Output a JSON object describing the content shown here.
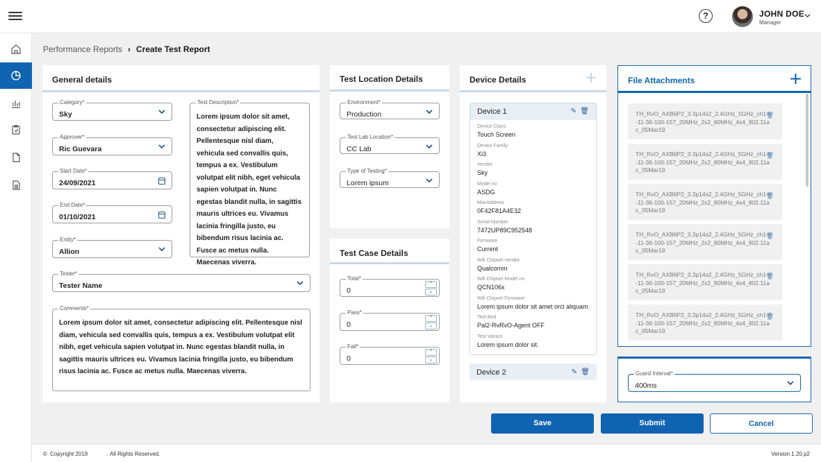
{
  "header": {
    "user_name": "JOHN DOE",
    "user_role": "Manager"
  },
  "breadcrumb": {
    "parent": "Performance Reports",
    "current": "Create Test Report"
  },
  "general": {
    "title": "General details",
    "category": {
      "label": "Category*",
      "value": "Sky"
    },
    "approver": {
      "label": "Approver*",
      "value": "Ric Guevara"
    },
    "start_date": {
      "label": "Start Date*",
      "value": "24/09/2021"
    },
    "end_date": {
      "label": "End Date*",
      "value": "01/10/2021"
    },
    "entity": {
      "label": "Entity*",
      "value": "Allion"
    },
    "description": {
      "label": "Test Description*",
      "value": "Lorem ipsum dolor sit amet, consectetur adipiscing elit. Pellentesque nisl diam, vehicula sed convallis quis, tempus a ex. Vestibulum volutpat elit nibh, eget vehicula sapien volutpat in. Nunc egestas blandit nulla, in sagittis mauris ultrices eu. Vivamus lacinia fringilla justo, eu bibendum risus lacinia ac. Fusce ac metus nulla. Maecenas viverra."
    },
    "tester": {
      "label": "Tester*",
      "value": "Tester Name"
    },
    "comments": {
      "label": "Comments*",
      "value": "Lorem ipsum dolor sit amet, consectetur adipiscing elit. Pellentesque nisl diam, vehicula sed convallis quis, tempus a ex. Vestibulum volutpat elit nibh, eget vehicula sapien volutpat in. Nunc egestas blandit nulla, in sagittis mauris ultrices eu. Vivamus lacinia fringilla justo, eu bibendum risus lacinia ac. Fusce ac metus nulla. Maecenas viverra."
    }
  },
  "location": {
    "title": "Test Location Details",
    "environment": {
      "label": "Environment*",
      "value": "Production"
    },
    "lab": {
      "label": "Test Lab Location*",
      "value": "CC Lab"
    },
    "testing_type": {
      "label": "Type of Testing*",
      "value": "Lorem ipsum"
    }
  },
  "testcase": {
    "title": "Test Case Details",
    "total": {
      "label": "Total*",
      "value": "0"
    },
    "pass": {
      "label": "Pass*",
      "value": "0"
    },
    "fail": {
      "label": "Fail*",
      "value": "0"
    }
  },
  "devices": {
    "title": "Device Details",
    "device1": {
      "name": "Device 1",
      "fields": [
        {
          "k": "Device Class",
          "v": "Touch Screen"
        },
        {
          "k": "Device Family",
          "v": "Xi3"
        },
        {
          "k": "Vendor",
          "v": "Sky"
        },
        {
          "k": "Model no",
          "v": "ASDG"
        },
        {
          "k": "MacAddress",
          "v": "0F42F81A4E32"
        },
        {
          "k": "Serial Number",
          "v": "7472UP89C952548"
        },
        {
          "k": "Firmware",
          "v": "Current"
        },
        {
          "k": "Wifi Chipset Vendor",
          "v": "Qualcomm"
        },
        {
          "k": "Wifi Chipset Model no",
          "v": "QCN106x"
        },
        {
          "k": "Wifi Chipset Firmware",
          "v": "Lorem ipsum dolor sit amet orci aliquam."
        },
        {
          "k": "Test Bed",
          "v": "Pal2-RvRvO-Agent OFF"
        },
        {
          "k": "Test Variant",
          "v": "Lorem ipsum dolor sit."
        }
      ]
    },
    "device2": {
      "name": "Device 2"
    }
  },
  "attachments": {
    "title": "File Attachments",
    "files": [
      "TH_RvO_AXB6P2_3.3p14s2_2.4GHz_5GHz_ch1-6-11-36-100-157_20MHz_2x2_80MHz_4x4_802.11ac_05Mar19",
      "TH_RvO_AXB6P2_3.3p14s2_2.4GHz_5GHz_ch1-6-11-36-100-157_20MHz_2x2_80MHz_4x4_802.11ac_05Mar19",
      "TH_RvO_AXB6P2_3.3p14s2_2.4GHz_5GHz_ch1-6-11-36-100-157_20MHz_2x2_80MHz_4x4_802.11ac_05Mar19",
      "TH_RvO_AXB6P2_3.3p14s2_2.4GHz_5GHz_ch1-6-11-36-100-157_20MHz_2x2_80MHz_4x4_802.11ac_05Mar19",
      "TH_RvO_AXB6P2_3.3p14s2_2.4GHz_5GHz_ch1-6-11-36-100-157_20MHz_2x2_80MHz_4x4_802.11ac_05Mar19",
      "TH_RvO_AXB6P2_3.3p14s2_2.4GHz_5GHz_ch1-6-11-36-100-157_20MHz_2x2_80MHz_4x4_802.11ac_05Mar19"
    ]
  },
  "guard": {
    "label": "Guard Interval*",
    "value": "400ms"
  },
  "actions": {
    "save": "Save",
    "submit": "Submit",
    "cancel": "Cancel"
  },
  "footer": {
    "copyright": "Copyright 2019",
    "rights": ". All Rights Reserved.",
    "version": "Version 1.20.p2"
  },
  "colors": {
    "accent": "#1063b1",
    "panel_rule": "#c8d8ea"
  }
}
